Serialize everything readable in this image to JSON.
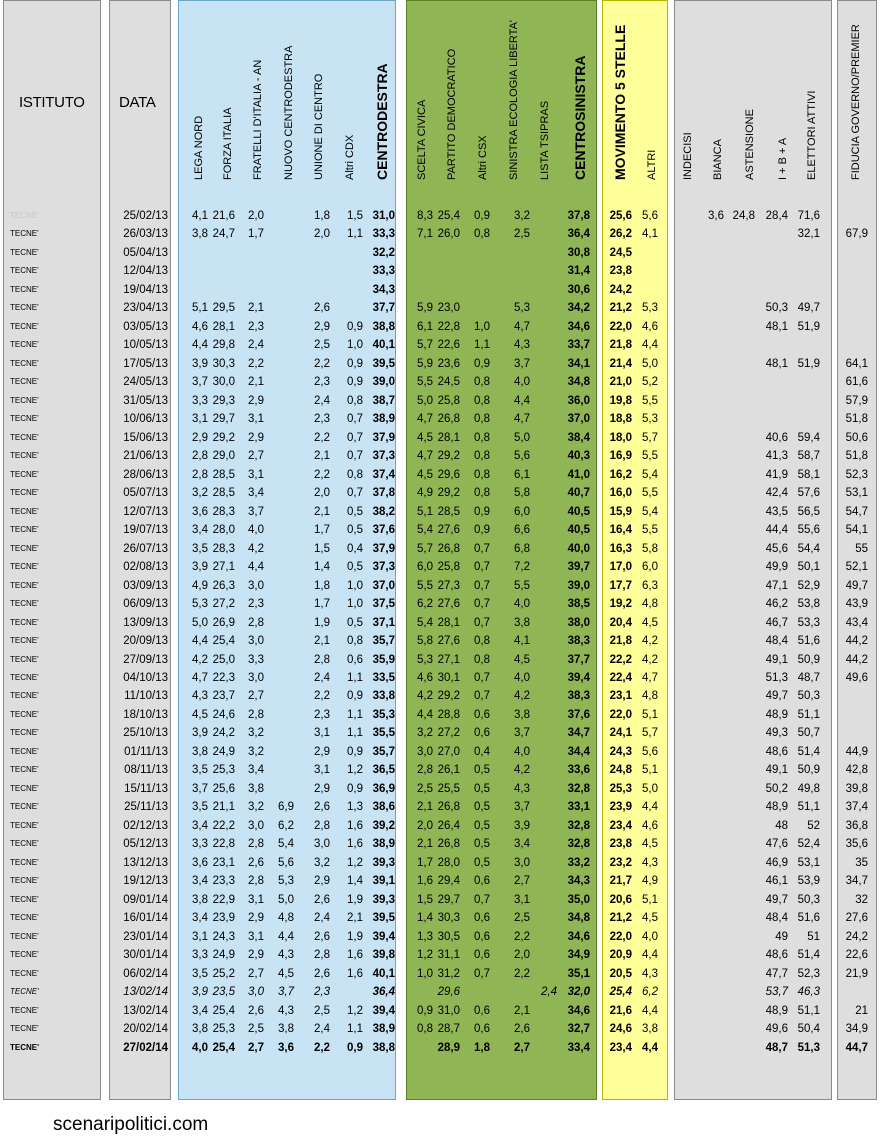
{
  "headers": {
    "istituto": "ISTITUTO",
    "data": "DATA",
    "columns": [
      "LEGA NORD",
      "FORZA ITALIA",
      "FRATELLI D'ITALIA - AN",
      "NUOVO  CENTRODESTRA",
      "UNIONE DI CENTRO",
      "Altri CDX",
      "CENTRODESTRA",
      "SCELTA CIVICA",
      "PARTITO DEMOCRATICO",
      "Altri CSX",
      "SINISTRA ECOLOGIA LIBERTA'",
      "LISTA TSIPRAS",
      "CENTROSINISTRA",
      "MOVIMENTO 5 STELLE",
      "ALTRI",
      "INDECISI",
      "BIANCA",
      "ASTENSIONE",
      "I + B + A",
      "ELETTORI ATTIVI",
      "FIDUCIA GOVERNO/PREMIER"
    ]
  },
  "rows": [
    [
      "TECNE'",
      "25/02/13",
      "4,1",
      "21,6",
      "2,0",
      "",
      "1,8",
      "1,5",
      "31,0",
      "8,3",
      "25,4",
      "0,9",
      "3,2",
      "",
      "37,8",
      "25,6",
      "5,6",
      "",
      "3,6",
      "24,8",
      "28,4",
      "71,6",
      ""
    ],
    [
      "TECNE'",
      "26/03/13",
      "3,8",
      "24,7",
      "1,7",
      "",
      "2,0",
      "1,1",
      "33,3",
      "7,1",
      "26,0",
      "0,8",
      "2,5",
      "",
      "36,4",
      "26,2",
      "4,1",
      "",
      "",
      "",
      "",
      "32,1",
      "67,9"
    ],
    [
      "TECNE'",
      "05/04/13",
      "",
      "",
      "",
      "",
      "",
      "",
      "32,2",
      "",
      "",
      "",
      "",
      "",
      "30,8",
      "24,5",
      "",
      "",
      "",
      "",
      "",
      "",
      ""
    ],
    [
      "TECNE'",
      "12/04/13",
      "",
      "",
      "",
      "",
      "",
      "",
      "33,3",
      "",
      "",
      "",
      "",
      "",
      "31,4",
      "23,8",
      "",
      "",
      "",
      "",
      "",
      "",
      ""
    ],
    [
      "TECNE'",
      "19/04/13",
      "",
      "",
      "",
      "",
      "",
      "",
      "34,3",
      "",
      "",
      "",
      "",
      "",
      "30,6",
      "24,2",
      "",
      "",
      "",
      "",
      "",
      "",
      ""
    ],
    [
      "TECNE'",
      "23/04/13",
      "5,1",
      "29,5",
      "2,1",
      "",
      "2,6",
      "",
      "37,7",
      "5,9",
      "23,0",
      "",
      "5,3",
      "",
      "34,2",
      "21,2",
      "5,3",
      "",
      "",
      "",
      "50,3",
      "49,7",
      ""
    ],
    [
      "TECNE'",
      "03/05/13",
      "4,6",
      "28,1",
      "2,3",
      "",
      "2,9",
      "0,9",
      "38,8",
      "6,1",
      "22,8",
      "1,0",
      "4,7",
      "",
      "34,6",
      "22,0",
      "4,6",
      "",
      "",
      "",
      "48,1",
      "51,9",
      ""
    ],
    [
      "TECNE'",
      "10/05/13",
      "4,4",
      "29,8",
      "2,4",
      "",
      "2,5",
      "1,0",
      "40,1",
      "5,7",
      "22,6",
      "1,1",
      "4,3",
      "",
      "33,7",
      "21,8",
      "4,4",
      "",
      "",
      "",
      "",
      "",
      ""
    ],
    [
      "TECNE'",
      "17/05/13",
      "3,9",
      "30,3",
      "2,2",
      "",
      "2,2",
      "0,9",
      "39,5",
      "5,9",
      "23,6",
      "0,9",
      "3,7",
      "",
      "34,1",
      "21,4",
      "5,0",
      "",
      "",
      "",
      "48,1",
      "51,9",
      "64,1"
    ],
    [
      "TECNE'",
      "24/05/13",
      "3,7",
      "30,0",
      "2,1",
      "",
      "2,3",
      "0,9",
      "39,0",
      "5,5",
      "24,5",
      "0,8",
      "4,0",
      "",
      "34,8",
      "21,0",
      "5,2",
      "",
      "",
      "",
      "",
      "",
      "61,6"
    ],
    [
      "TECNE'",
      "31/05/13",
      "3,3",
      "29,3",
      "2,9",
      "",
      "2,4",
      "0,8",
      "38,7",
      "5,0",
      "25,8",
      "0,8",
      "4,4",
      "",
      "36,0",
      "19,8",
      "5,5",
      "",
      "",
      "",
      "",
      "",
      "57,9"
    ],
    [
      "TECNE'",
      "10/06/13",
      "3,1",
      "29,7",
      "3,1",
      "",
      "2,3",
      "0,7",
      "38,9",
      "4,7",
      "26,8",
      "0,8",
      "4,7",
      "",
      "37,0",
      "18,8",
      "5,3",
      "",
      "",
      "",
      "",
      "",
      "51,8"
    ],
    [
      "TECNE'",
      "15/06/13",
      "2,9",
      "29,2",
      "2,9",
      "",
      "2,2",
      "0,7",
      "37,9",
      "4,5",
      "28,1",
      "0,8",
      "5,0",
      "",
      "38,4",
      "18,0",
      "5,7",
      "",
      "",
      "",
      "40,6",
      "59,4",
      "50,6"
    ],
    [
      "TECNE'",
      "21/06/13",
      "2,8",
      "29,0",
      "2,7",
      "",
      "2,1",
      "0,7",
      "37,3",
      "4,7",
      "29,2",
      "0,8",
      "5,6",
      "",
      "40,3",
      "16,9",
      "5,5",
      "",
      "",
      "",
      "41,3",
      "58,7",
      "51,8"
    ],
    [
      "TECNE'",
      "28/06/13",
      "2,8",
      "28,5",
      "3,1",
      "",
      "2,2",
      "0,8",
      "37,4",
      "4,5",
      "29,6",
      "0,8",
      "6,1",
      "",
      "41,0",
      "16,2",
      "5,4",
      "",
      "",
      "",
      "41,9",
      "58,1",
      "52,3"
    ],
    [
      "TECNE'",
      "05/07/13",
      "3,2",
      "28,5",
      "3,4",
      "",
      "2,0",
      "0,7",
      "37,8",
      "4,9",
      "29,2",
      "0,8",
      "5,8",
      "",
      "40,7",
      "16,0",
      "5,5",
      "",
      "",
      "",
      "42,4",
      "57,6",
      "53,1"
    ],
    [
      "TECNE'",
      "12/07/13",
      "3,6",
      "28,3",
      "3,7",
      "",
      "2,1",
      "0,5",
      "38,2",
      "5,1",
      "28,5",
      "0,9",
      "6,0",
      "",
      "40,5",
      "15,9",
      "5,4",
      "",
      "",
      "",
      "43,5",
      "56,5",
      "54,7"
    ],
    [
      "TECNE'",
      "19/07/13",
      "3,4",
      "28,0",
      "4,0",
      "",
      "1,7",
      "0,5",
      "37,6",
      "5,4",
      "27,6",
      "0,9",
      "6,6",
      "",
      "40,5",
      "16,4",
      "5,5",
      "",
      "",
      "",
      "44,4",
      "55,6",
      "54,1"
    ],
    [
      "TECNE'",
      "26/07/13",
      "3,5",
      "28,3",
      "4,2",
      "",
      "1,5",
      "0,4",
      "37,9",
      "5,7",
      "26,8",
      "0,7",
      "6,8",
      "",
      "40,0",
      "16,3",
      "5,8",
      "",
      "",
      "",
      "45,6",
      "54,4",
      "55"
    ],
    [
      "TECNE'",
      "02/08/13",
      "3,9",
      "27,1",
      "4,4",
      "",
      "1,4",
      "0,5",
      "37,3",
      "6,0",
      "25,8",
      "0,7",
      "7,2",
      "",
      "39,7",
      "17,0",
      "6,0",
      "",
      "",
      "",
      "49,9",
      "50,1",
      "52,1"
    ],
    [
      "TECNE'",
      "03/09/13",
      "4,9",
      "26,3",
      "3,0",
      "",
      "1,8",
      "1,0",
      "37,0",
      "5,5",
      "27,3",
      "0,7",
      "5,5",
      "",
      "39,0",
      "17,7",
      "6,3",
      "",
      "",
      "",
      "47,1",
      "52,9",
      "49,7"
    ],
    [
      "TECNE'",
      "06/09/13",
      "5,3",
      "27,2",
      "2,3",
      "",
      "1,7",
      "1,0",
      "37,5",
      "6,2",
      "27,6",
      "0,7",
      "4,0",
      "",
      "38,5",
      "19,2",
      "4,8",
      "",
      "",
      "",
      "46,2",
      "53,8",
      "43,9"
    ],
    [
      "TECNE'",
      "13/09/13",
      "5,0",
      "26,9",
      "2,8",
      "",
      "1,9",
      "0,5",
      "37,1",
      "5,4",
      "28,1",
      "0,7",
      "3,8",
      "",
      "38,0",
      "20,4",
      "4,5",
      "",
      "",
      "",
      "46,7",
      "53,3",
      "43,4"
    ],
    [
      "TECNE'",
      "20/09/13",
      "4,4",
      "25,4",
      "3,0",
      "",
      "2,1",
      "0,8",
      "35,7",
      "5,8",
      "27,6",
      "0,8",
      "4,1",
      "",
      "38,3",
      "21,8",
      "4,2",
      "",
      "",
      "",
      "48,4",
      "51,6",
      "44,2"
    ],
    [
      "TECNE'",
      "27/09/13",
      "4,2",
      "25,0",
      "3,3",
      "",
      "2,8",
      "0,6",
      "35,9",
      "5,3",
      "27,1",
      "0,8",
      "4,5",
      "",
      "37,7",
      "22,2",
      "4,2",
      "",
      "",
      "",
      "49,1",
      "50,9",
      "44,2"
    ],
    [
      "TECNE'",
      "04/10/13",
      "4,7",
      "22,3",
      "3,0",
      "",
      "2,4",
      "1,1",
      "33,5",
      "4,6",
      "30,1",
      "0,7",
      "4,0",
      "",
      "39,4",
      "22,4",
      "4,7",
      "",
      "",
      "",
      "51,3",
      "48,7",
      "49,6"
    ],
    [
      "TECNE'",
      "11/10/13",
      "4,3",
      "23,7",
      "2,7",
      "",
      "2,2",
      "0,9",
      "33,8",
      "4,2",
      "29,2",
      "0,7",
      "4,2",
      "",
      "38,3",
      "23,1",
      "4,8",
      "",
      "",
      "",
      "49,7",
      "50,3",
      ""
    ],
    [
      "TECNE'",
      "18/10/13",
      "4,5",
      "24,6",
      "2,8",
      "",
      "2,3",
      "1,1",
      "35,3",
      "4,4",
      "28,8",
      "0,6",
      "3,8",
      "",
      "37,6",
      "22,0",
      "5,1",
      "",
      "",
      "",
      "48,9",
      "51,1",
      ""
    ],
    [
      "TECNE'",
      "25/10/13",
      "3,9",
      "24,2",
      "3,2",
      "",
      "3,1",
      "1,1",
      "35,5",
      "3,2",
      "27,2",
      "0,6",
      "3,7",
      "",
      "34,7",
      "24,1",
      "5,7",
      "",
      "",
      "",
      "49,3",
      "50,7",
      ""
    ],
    [
      "TECNE'",
      "01/11/13",
      "3,8",
      "24,9",
      "3,2",
      "",
      "2,9",
      "0,9",
      "35,7",
      "3,0",
      "27,0",
      "0,4",
      "4,0",
      "",
      "34,4",
      "24,3",
      "5,6",
      "",
      "",
      "",
      "48,6",
      "51,4",
      "44,9"
    ],
    [
      "TECNE'",
      "08/11/13",
      "3,5",
      "25,3",
      "3,4",
      "",
      "3,1",
      "1,2",
      "36,5",
      "2,8",
      "26,1",
      "0,5",
      "4,2",
      "",
      "33,6",
      "24,8",
      "5,1",
      "",
      "",
      "",
      "49,1",
      "50,9",
      "42,8"
    ],
    [
      "TECNE'",
      "15/11/13",
      "3,7",
      "25,6",
      "3,8",
      "",
      "2,9",
      "0,9",
      "36,9",
      "2,5",
      "25,5",
      "0,5",
      "4,3",
      "",
      "32,8",
      "25,3",
      "5,0",
      "",
      "",
      "",
      "50,2",
      "49,8",
      "39,8"
    ],
    [
      "TECNE'",
      "25/11/13",
      "3,5",
      "21,1",
      "3,2",
      "6,9",
      "2,6",
      "1,3",
      "38,6",
      "2,1",
      "26,8",
      "0,5",
      "3,7",
      "",
      "33,1",
      "23,9",
      "4,4",
      "",
      "",
      "",
      "48,9",
      "51,1",
      "37,4"
    ],
    [
      "TECNE'",
      "02/12/13",
      "3,4",
      "22,2",
      "3,0",
      "6,2",
      "2,8",
      "1,6",
      "39,2",
      "2,0",
      "26,4",
      "0,5",
      "3,9",
      "",
      "32,8",
      "23,4",
      "4,6",
      "",
      "",
      "",
      "48",
      "52",
      "36,8"
    ],
    [
      "TECNE'",
      "05/12/13",
      "3,3",
      "22,8",
      "2,8",
      "5,4",
      "3,0",
      "1,6",
      "38,9",
      "2,1",
      "26,8",
      "0,5",
      "3,4",
      "",
      "32,8",
      "23,8",
      "4,5",
      "",
      "",
      "",
      "47,6",
      "52,4",
      "35,6"
    ],
    [
      "TECNE'",
      "13/12/13",
      "3,6",
      "23,1",
      "2,6",
      "5,6",
      "3,2",
      "1,2",
      "39,3",
      "1,7",
      "28,0",
      "0,5",
      "3,0",
      "",
      "33,2",
      "23,2",
      "4,3",
      "",
      "",
      "",
      "46,9",
      "53,1",
      "35"
    ],
    [
      "TECNE'",
      "19/12/13",
      "3,4",
      "23,3",
      "2,8",
      "5,3",
      "2,9",
      "1,4",
      "39,1",
      "1,6",
      "29,4",
      "0,6",
      "2,7",
      "",
      "34,3",
      "21,7",
      "4,9",
      "",
      "",
      "",
      "46,1",
      "53,9",
      "34,7"
    ],
    [
      "TECNE'",
      "09/01/14",
      "3,8",
      "22,9",
      "3,1",
      "5,0",
      "2,6",
      "1,9",
      "39,3",
      "1,5",
      "29,7",
      "0,7",
      "3,1",
      "",
      "35,0",
      "20,6",
      "5,1",
      "",
      "",
      "",
      "49,7",
      "50,3",
      "32"
    ],
    [
      "TECNE'",
      "16/01/14",
      "3,4",
      "23,9",
      "2,9",
      "4,8",
      "2,4",
      "2,1",
      "39,5",
      "1,4",
      "30,3",
      "0,6",
      "2,5",
      "",
      "34,8",
      "21,2",
      "4,5",
      "",
      "",
      "",
      "48,4",
      "51,6",
      "27,6"
    ],
    [
      "TECNE'",
      "23/01/14",
      "3,1",
      "24,3",
      "3,1",
      "4,4",
      "2,6",
      "1,9",
      "39,4",
      "1,3",
      "30,5",
      "0,6",
      "2,2",
      "",
      "34,6",
      "22,0",
      "4,0",
      "",
      "",
      "",
      "49",
      "51",
      "24,2"
    ],
    [
      "TECNE'",
      "30/01/14",
      "3,3",
      "24,9",
      "2,9",
      "4,3",
      "2,8",
      "1,6",
      "39,8",
      "1,2",
      "31,1",
      "0,6",
      "2,0",
      "",
      "34,9",
      "20,9",
      "4,4",
      "",
      "",
      "",
      "48,6",
      "51,4",
      "22,6"
    ],
    [
      "TECNE'",
      "06/02/14",
      "3,5",
      "25,2",
      "2,7",
      "4,5",
      "2,6",
      "1,6",
      "40,1",
      "1,0",
      "31,2",
      "0,7",
      "2,2",
      "",
      "35,1",
      "20,5",
      "4,3",
      "",
      "",
      "",
      "47,7",
      "52,3",
      "21,9"
    ],
    [
      "TECNE'",
      "13/02/14",
      "3,9",
      "23,5",
      "3,0",
      "3,7",
      "2,3",
      "",
      "36,4",
      "",
      "29,6",
      "",
      "",
      "2,4",
      "32,0",
      "25,4",
      "6,2",
      "",
      "",
      "",
      "53,7",
      "46,3",
      ""
    ],
    [
      "TECNE'",
      "13/02/14",
      "3,4",
      "25,4",
      "2,6",
      "4,3",
      "2,5",
      "1,2",
      "39,4",
      "0,9",
      "31,0",
      "0,6",
      "2,1",
      "",
      "34,6",
      "21,6",
      "4,4",
      "",
      "",
      "",
      "48,9",
      "51,1",
      "21"
    ],
    [
      "TECNE'",
      "20/02/14",
      "3,8",
      "25,3",
      "2,5",
      "3,8",
      "2,4",
      "1,1",
      "38,9",
      "0,8",
      "28,7",
      "0,6",
      "2,6",
      "",
      "32,7",
      "24,6",
      "3,8",
      "",
      "",
      "",
      "49,6",
      "50,4",
      "34,9"
    ],
    [
      "TECNE'",
      "27/02/14",
      "4,0",
      "25,4",
      "2,7",
      "3,6",
      "2,2",
      "0,9",
      "38,8",
      "",
      "28,9",
      "1,8",
      "2,7",
      "",
      "33,4",
      "23,4",
      "4,4",
      "",
      "",
      "",
      "48,7",
      "51,3",
      "44,7"
    ]
  ],
  "footer": "scenaripolitici.com",
  "colors": {
    "centrodestra": "#c8e3f4",
    "centrosinistra": "#8fb554",
    "m5s": "#ffff9a",
    "grey": "#dedede"
  }
}
